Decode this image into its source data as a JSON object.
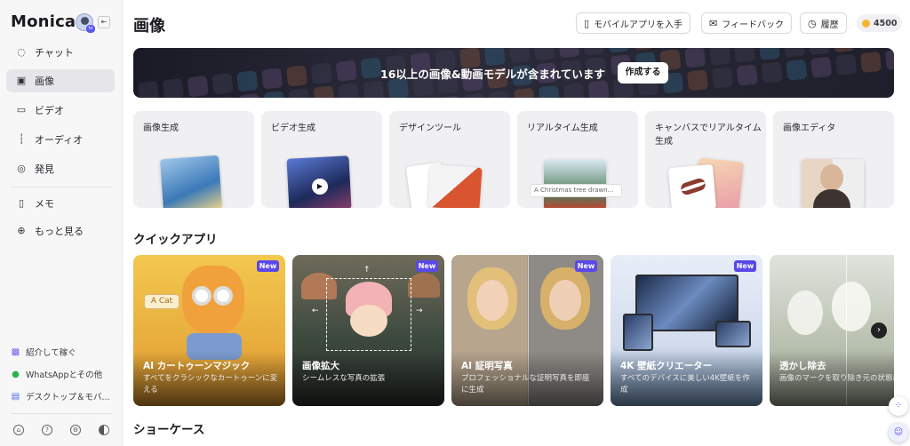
{
  "sidebar": {
    "brand": "Monica",
    "avatar_badge": "tx",
    "collapse_icon": "collapse-icon",
    "items": [
      {
        "label": "チャット",
        "icon": "chat-icon",
        "active": false
      },
      {
        "label": "画像",
        "icon": "image-icon",
        "active": true
      },
      {
        "label": "ビデオ",
        "icon": "video-icon",
        "active": false
      },
      {
        "label": "オーディオ",
        "icon": "audio-icon",
        "active": false
      },
      {
        "label": "発見",
        "icon": "compass-icon",
        "active": false
      },
      {
        "label": "メモ",
        "icon": "bookmark-icon",
        "active": false
      },
      {
        "label": "もっと見る",
        "icon": "plus-icon",
        "active": false
      }
    ],
    "bottom_links": [
      {
        "label": "紹介して稼ぐ",
        "icon": "gift-icon"
      },
      {
        "label": "WhatsAppとその他",
        "icon": "whatsapp-icon"
      },
      {
        "label": "デスクトップ＆モバ...",
        "icon": "devices-icon"
      }
    ],
    "footer_icons": [
      "home-icon",
      "help-icon",
      "settings-icon",
      "theme-icon"
    ]
  },
  "header": {
    "title": "画像",
    "mobile_app_label": "モバイルアプリを入手",
    "feedback_label": "フィードバック",
    "history_label": "履歴",
    "credits": "4500"
  },
  "banner": {
    "text": "16以上の画像&動画モデルが含まれています",
    "button_label": "作成する"
  },
  "tools": [
    {
      "label": "画像生成"
    },
    {
      "label": "ビデオ生成"
    },
    {
      "label": "デザインツール"
    },
    {
      "label": "リアルタイム生成",
      "sample_prompt": "A Christmas tree drawn..."
    },
    {
      "label": "キャンバスでリアルタイム生成"
    },
    {
      "label": "画像エディタ"
    }
  ],
  "quick_apps": {
    "title": "クイックアプリ",
    "items": [
      {
        "title": "AI カートゥーンマジック",
        "desc": "すべてをクラシックなカートゥーンに変える",
        "badge": "New",
        "tag": "A Cat"
      },
      {
        "title": "画像拡大",
        "desc": "シームレスな写真の拡張",
        "badge": "New"
      },
      {
        "title": "AI 証明写真",
        "desc": "プロフェッショナルな証明写真を即座に生成",
        "badge": "New"
      },
      {
        "title": "4K 壁紙クリエーター",
        "desc": "すべてのデバイスに美しい4K壁紙を作成",
        "badge": "New"
      },
      {
        "title": "透かし除去",
        "desc": "画像のマークを取り除き元の状態に戻す"
      }
    ]
  },
  "showcase": {
    "title": "ショーケース"
  }
}
